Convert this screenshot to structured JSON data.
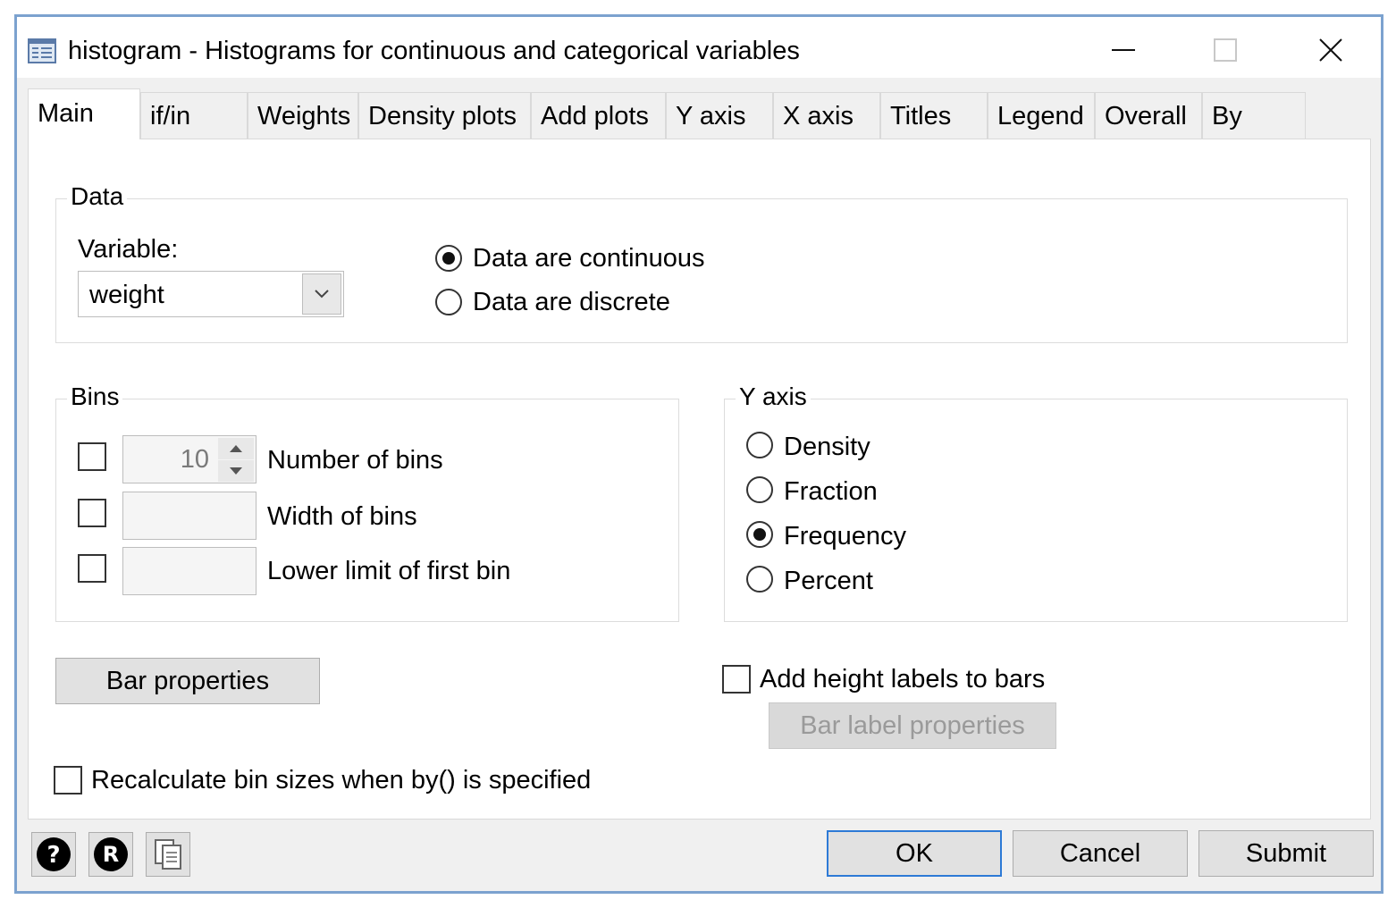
{
  "window": {
    "title": "histogram - Histograms for continuous and categorical variables"
  },
  "tabs": [
    {
      "label": "Main"
    },
    {
      "label": "if/in"
    },
    {
      "label": "Weights"
    },
    {
      "label": "Density plots"
    },
    {
      "label": "Add plots"
    },
    {
      "label": "Y axis"
    },
    {
      "label": "X axis"
    },
    {
      "label": "Titles"
    },
    {
      "label": "Legend"
    },
    {
      "label": "Overall"
    },
    {
      "label": "By"
    }
  ],
  "data_group": {
    "legend": "Data",
    "variable_label": "Variable:",
    "variable_value": "weight",
    "continuous_label": "Data are continuous",
    "discrete_label": "Data are discrete",
    "selected": "continuous"
  },
  "bins_group": {
    "legend": "Bins",
    "number_value": "10",
    "number_label": "Number of bins",
    "width_label": "Width of bins",
    "lower_label": "Lower limit of first bin"
  },
  "yaxis_group": {
    "legend": "Y axis",
    "options": [
      "Density",
      "Fraction",
      "Frequency",
      "Percent"
    ],
    "selected": "Frequency"
  },
  "buttons": {
    "bar_properties": "Bar properties",
    "add_height_labels": "Add height labels to bars",
    "bar_label_properties": "Bar label properties",
    "recalculate": "Recalculate bin sizes when by() is specified",
    "ok": "OK",
    "cancel": "Cancel",
    "submit": "Submit"
  },
  "icons": {
    "help": "help-icon",
    "reset": "reset-icon",
    "copy": "copy-icon"
  }
}
